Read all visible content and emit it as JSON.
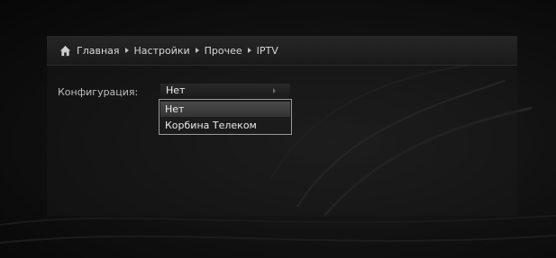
{
  "breadcrumb": {
    "home_icon": "home-icon",
    "items": [
      "Главная",
      "Настройки",
      "Прочее",
      "IPTV"
    ]
  },
  "config": {
    "label": "Конфигурация:",
    "selected_value": "Нет",
    "options": [
      "Нет",
      "Корбина Телеком"
    ]
  },
  "colors": {
    "background": "#0b0b0b",
    "text": "#d8d8d8",
    "dropdown_border": "#9a9a9a"
  }
}
